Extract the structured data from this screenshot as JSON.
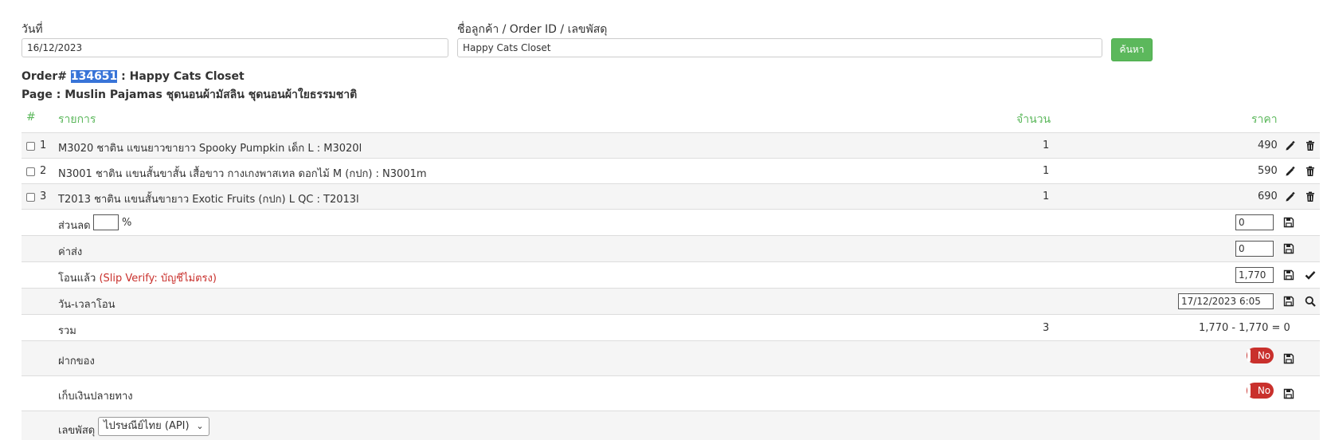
{
  "filters": {
    "date_label": "วันที่",
    "date_value": "16/12/2023",
    "customer_label": "ชื่อลูกค้า / Order ID / เลขพัสดุ",
    "customer_value": "Happy Cats Closet",
    "search_label": "ค้นหา"
  },
  "order": {
    "prefix": "Order# ",
    "id": "134651",
    "customer_suffix": " : Happy Cats Closet",
    "page_line": "Page : Muslin Pajamas ชุดนอนผ้ามัสลิน ชุดนอนผ้าใยธรรมชาติ"
  },
  "table": {
    "headers": {
      "num": "#",
      "item": "รายการ",
      "qty": "จำนวน",
      "price": "ราคา"
    },
    "rows": [
      {
        "num": "1",
        "item": "M3020 ชาติน แขนยาวขายาว Spooky Pumpkin เด็ก L : M3020l",
        "qty": "1",
        "price": "490"
      },
      {
        "num": "2",
        "item": "N3001 ชาติน แขนสั้นขาสั้น เสื้อขาว กางเกงพาสเทล ดอกไม้ M (กปก) : N3001m",
        "qty": "1",
        "price": "590"
      },
      {
        "num": "3",
        "item": "T2013 ชาติน แขนสั้นขายาว Exotic Fruits (กปก) L QC : T2013l",
        "qty": "1",
        "price": "690"
      }
    ]
  },
  "summary": {
    "discount_label": "ส่วนลด",
    "discount_unit": "%",
    "discount_value": "0",
    "shipping_label": "ค่าส่ง",
    "shipping_value": "0",
    "transfer_label": "โอนแล้ว",
    "transfer_note": "(Slip Verify: บัญชีไม่ตรง)",
    "transfer_value": "1,770",
    "transfer_time_label": "วัน-เวลาโอน",
    "transfer_time_value": "17/12/2023 6:05",
    "total_label": "รวม",
    "total_qty": "3",
    "total_formula": "1,770 - 1,770 = 0",
    "deposit_label": "ฝากของ",
    "deposit_toggle": "No",
    "cod_label": "เก็บเงินปลายทาง",
    "cod_toggle": "No",
    "tracking_label": "เลขพัสดุ",
    "tracking_select": "ไปรษณีย์ไทย (API)"
  },
  "icons": {
    "edit": "pencil-icon",
    "delete": "trash-icon",
    "save": "floppy-disk-icon",
    "confirm": "check-icon",
    "search": "magnifier-icon"
  },
  "colors": {
    "accent": "#5cb85c",
    "highlight": "#3874d8",
    "danger": "#c9302c"
  }
}
